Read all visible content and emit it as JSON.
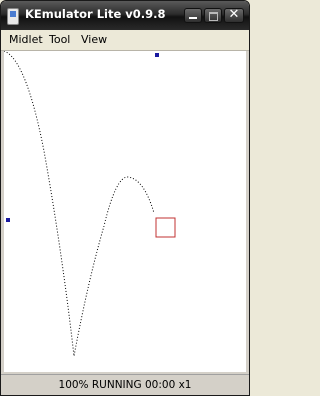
{
  "window": {
    "title": "KEmulator Lite v0.9.8",
    "close_glyph": "✕"
  },
  "menu": {
    "items": [
      "Midlet",
      "Tool",
      "View"
    ]
  },
  "status": {
    "text": "100% RUNNING 00:00 x1"
  },
  "colors": {
    "curve": "#000000",
    "marker": "#1a1aa0",
    "box": "#c03030"
  },
  "icons": [
    "app-icon",
    "minimize-icon",
    "maximize-icon",
    "close-icon"
  ]
}
